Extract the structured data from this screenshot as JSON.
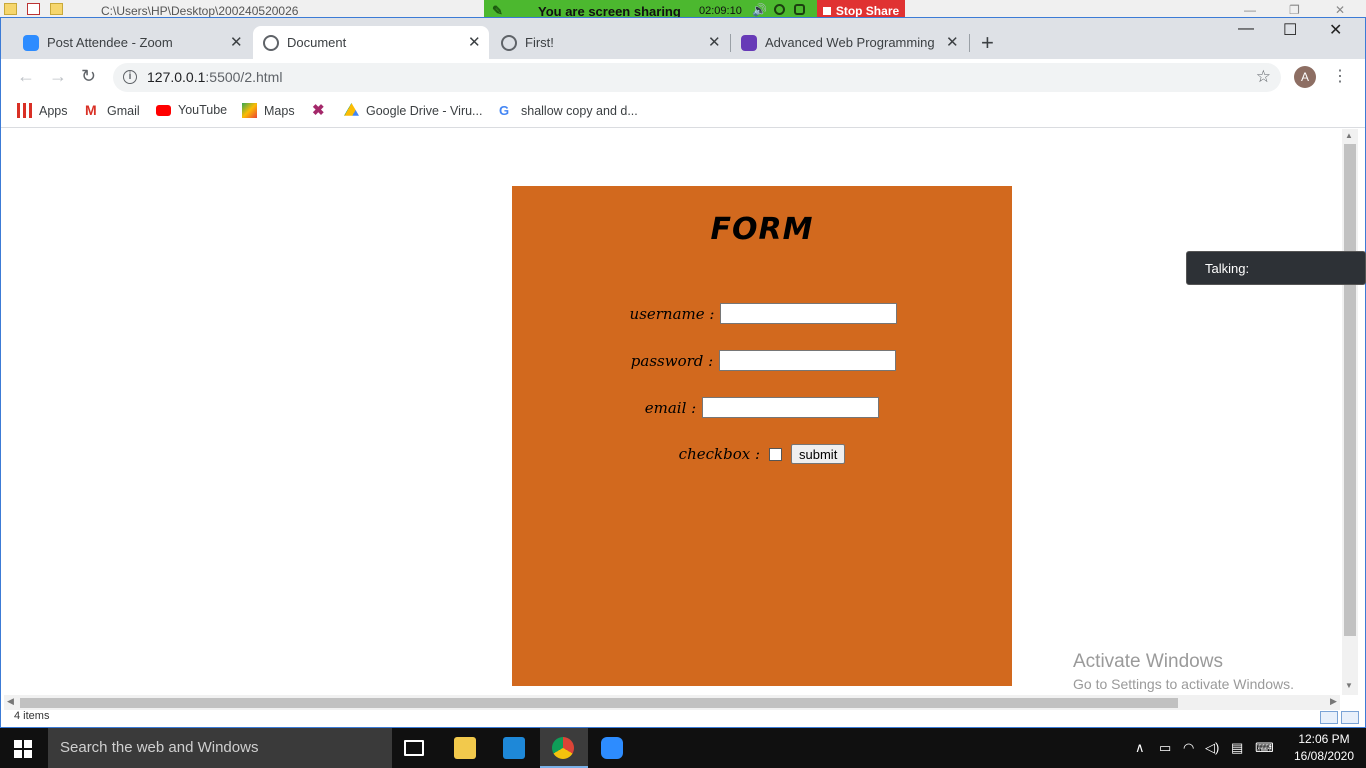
{
  "explorer": {
    "path": "C:\\Users\\HP\\Desktop\\200240520026",
    "status_items": "4 items"
  },
  "share_bar": {
    "message": "You are screen sharing",
    "time": "02:09:10",
    "stop_label": "Stop Share"
  },
  "browser": {
    "tabs": [
      {
        "title": "Post Attendee - Zoom",
        "favicon": "zoom-icon"
      },
      {
        "title": "Document",
        "favicon": "globe-icon"
      },
      {
        "title": "First!",
        "favicon": "globe-icon"
      },
      {
        "title": "Advanced Web Programming Eng",
        "favicon": "forms-icon"
      }
    ],
    "new_tab": "+",
    "url_host": "127.0.0.1",
    "url_rest": ":5500/2.html",
    "avatar_letter": "A",
    "bookmarks": [
      {
        "label": "Apps"
      },
      {
        "label": "Gmail"
      },
      {
        "label": "YouTube"
      },
      {
        "label": "Maps"
      },
      {
        "label": ""
      },
      {
        "label": "Google Drive - Viru..."
      },
      {
        "label": "shallow copy and d..."
      }
    ]
  },
  "form": {
    "title": "FORM",
    "username_label": "username :",
    "password_label": "password :",
    "email_label": "email :",
    "checkbox_label": "checkbox :",
    "submit_label": "submit",
    "bg_color": "#d2691e"
  },
  "zoom_talking": "Talking:",
  "activate": {
    "line1": "Activate Windows",
    "line2": "Go to Settings to activate Windows."
  },
  "taskbar": {
    "search_placeholder": "Search the web and Windows",
    "time": "12:06 PM",
    "date": "16/08/2020"
  }
}
